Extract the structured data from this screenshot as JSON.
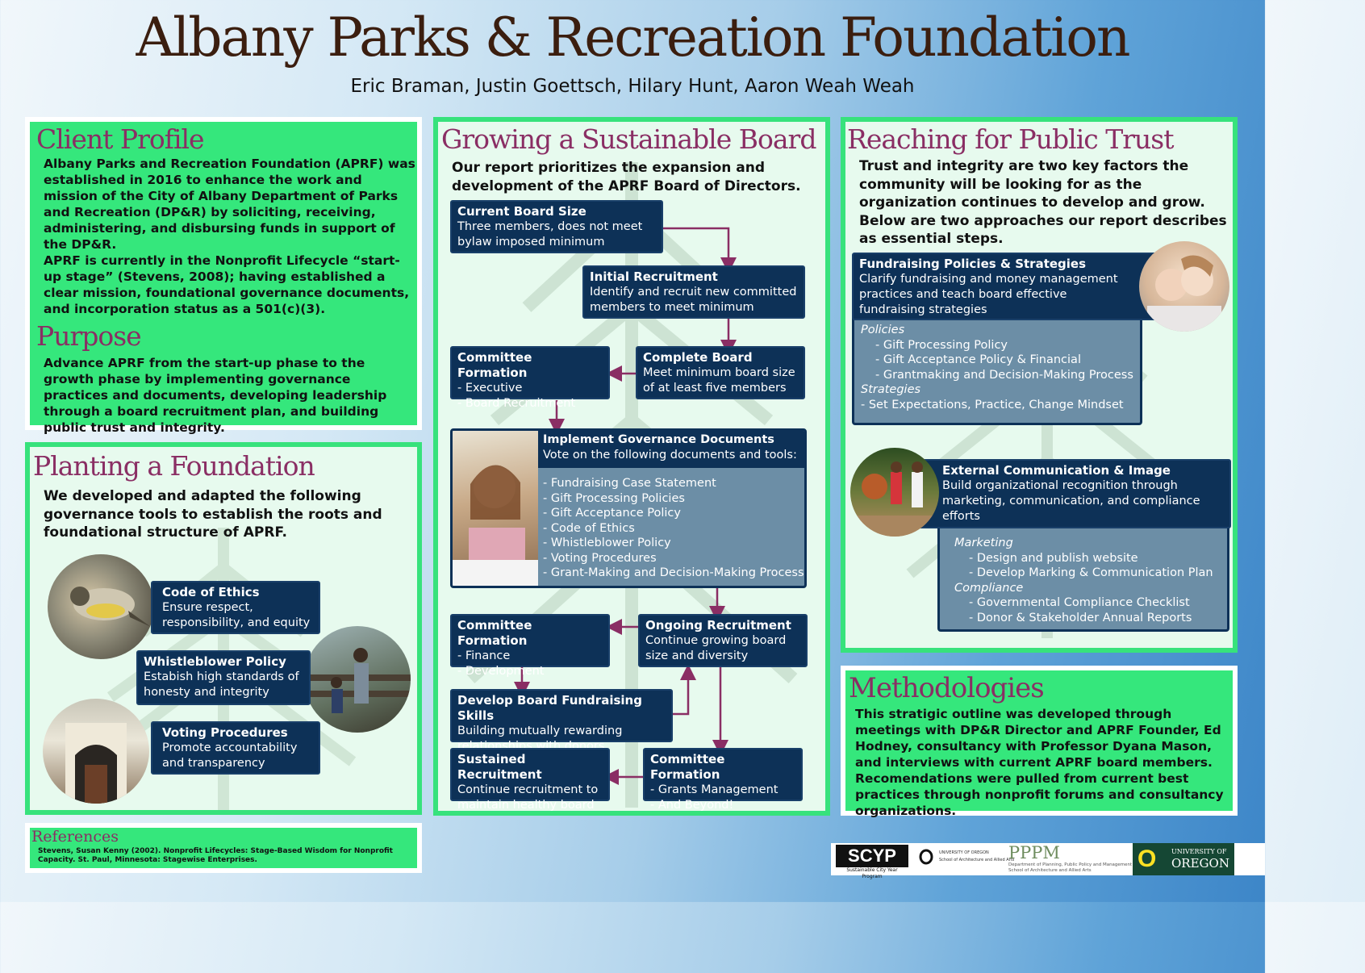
{
  "title": "Albany Parks & Recreation Foundation",
  "authors": "Eric Braman, Justin Goettsch, Hilary Hunt, Aaron Weah Weah",
  "client_profile": {
    "heading": "Client Profile",
    "p1": "Albany Parks and Recreation Foundation (APRF) was established in 2016 to enhance the work and mission of the City of Albany Department of Parks and Recreation (DP&R) by soliciting, receiving, administering, and disbursing funds in support of the DP&R.",
    "p2": "APRF is currently in the Nonprofit Lifecycle “start-up stage” (Stevens, 2008); having established a clear mission, foundational governance documents, and incorporation status as a 501(c)(3).",
    "purpose_heading": "Purpose",
    "purpose": "Advance APRF from the start-up phase to the growth phase by implementing governance practices and documents, developing leadership through a board recruitment plan, and building public trust and integrity."
  },
  "planting": {
    "heading": "Planting a Foundation",
    "intro": "We developed and adapted the following governance tools to establish the roots and foundational structure of APRF.",
    "items": [
      {
        "title": "Code of Ethics",
        "text": "Ensure respect, responsibility, and equity"
      },
      {
        "title": "Whistleblower Policy",
        "text": "Estabish high standards of honesty and integrity"
      },
      {
        "title": "Voting Procedures",
        "text": "Promote accountability and transparency"
      }
    ]
  },
  "references": {
    "heading": "References",
    "text": "Stevens, Susan Kenny (2002). Nonprofit Lifecycles: Stage-Based Wisdom for Nonprofit Capacity. St. Paul, Minnesota: Stagewise Enterprises."
  },
  "board": {
    "heading": "Growing a Sustainable Board",
    "intro": "Our report prioritizes the expansion and development of the APRF Board of Directors.",
    "current": {
      "title": "Current Board Size",
      "text": "Three members, does not meet bylaw imposed minimum"
    },
    "initial": {
      "title": "Initial Recruitment",
      "text": "Identify and recruit new committed members to meet minimum"
    },
    "committee1": {
      "title": "Committee Formation",
      "l1": "- Executive",
      "l2": "- Board Recruitment"
    },
    "complete": {
      "title": "Complete Board",
      "text": "Meet minimum board size of at least five members"
    },
    "governance": {
      "title": "Implement Governance Documents",
      "text": "Vote on the following documents and tools:",
      "items": [
        "- Fundraising Case Statement",
        "- Gift Processing Policies",
        "- Gift Acceptance Policy",
        "- Code of Ethics",
        "- Whistleblower Policy",
        "- Voting Procedures",
        "- Grant-Making and Decision-Making Process"
      ]
    },
    "committee2": {
      "title": "Committee Formation",
      "l1": "- Finance",
      "l2": "- Development"
    },
    "ongoing": {
      "title": "Ongoing Recruitment",
      "text": "Continue growing board size and diversity"
    },
    "skills": {
      "title": "Develop Board Fundraising Skills",
      "text": "Building mutually rewarding relationships with donors"
    },
    "sustained": {
      "title": "Sustained Recruitment",
      "text": "Continue recruitment to maintain healthy board"
    },
    "committee3": {
      "title": "Committee Formation",
      "l1": "- Grants Management",
      "l2": "- And Beyond!"
    }
  },
  "trust": {
    "heading": "Reaching for Public Trust",
    "intro": "Trust and integrity are two key factors the community will be looking for as the organization continues to develop and grow. Below are two approaches our report describes as essential steps.",
    "fund": {
      "title": "Fundraising Policies & Strategies",
      "text": "Clarify fundraising and money management practices and teach board effective fundraising strategies",
      "policies_label": "Policies",
      "policies": [
        "- Gift Processing Policy",
        "- Gift Acceptance Policy & Financial",
        "- Grantmaking and Decision-Making Process"
      ],
      "strategies_label": "Strategies",
      "strategies": [
        "- Set Expectations, Practice, Change Mindset"
      ]
    },
    "ext": {
      "title": "External Communication & Image",
      "text": "Build organizational recognition through marketing, communication, and compliance efforts",
      "marketing_label": "Marketing",
      "marketing": [
        "- Design and publish website",
        "- Develop Marking & Communication Plan"
      ],
      "compliance_label": "Compliance",
      "compliance": [
        "- Governmental Compliance Checklist",
        "- Donor & Stakeholder Annual Reports"
      ]
    }
  },
  "methodologies": {
    "heading": "Methodologies",
    "text": "This stratigic outline was developed through meetings with DP&R Director and APRF Founder, Ed Hodney, consultancy with Professor Dyana Mason, and interviews with current APRF board members. Recomendations were pulled from current best practices through nonprofit forums and consultancy organizations."
  },
  "logos": {
    "scyp": "SCYP",
    "scyp_sub": "Sustainable City Year Program",
    "uo_small": "UNIVERSITY OF OREGON",
    "uo_small_sub": "School of Architecture and Allied Arts",
    "pppm": "PPPM",
    "pppm_sub": "Department of Planning, Public Policy and Management",
    "pppm_sub2": "School of Architecture and Allied Arts",
    "uo_o": "O",
    "uo_line1": "UNIVERSITY OF",
    "uo_line2": "OREGON"
  },
  "colors": {
    "heading": "#8a2e64",
    "navy": "#0d3157",
    "green": "#35e77c",
    "title": "#3b1e0f",
    "arrow": "#8a2e64"
  }
}
